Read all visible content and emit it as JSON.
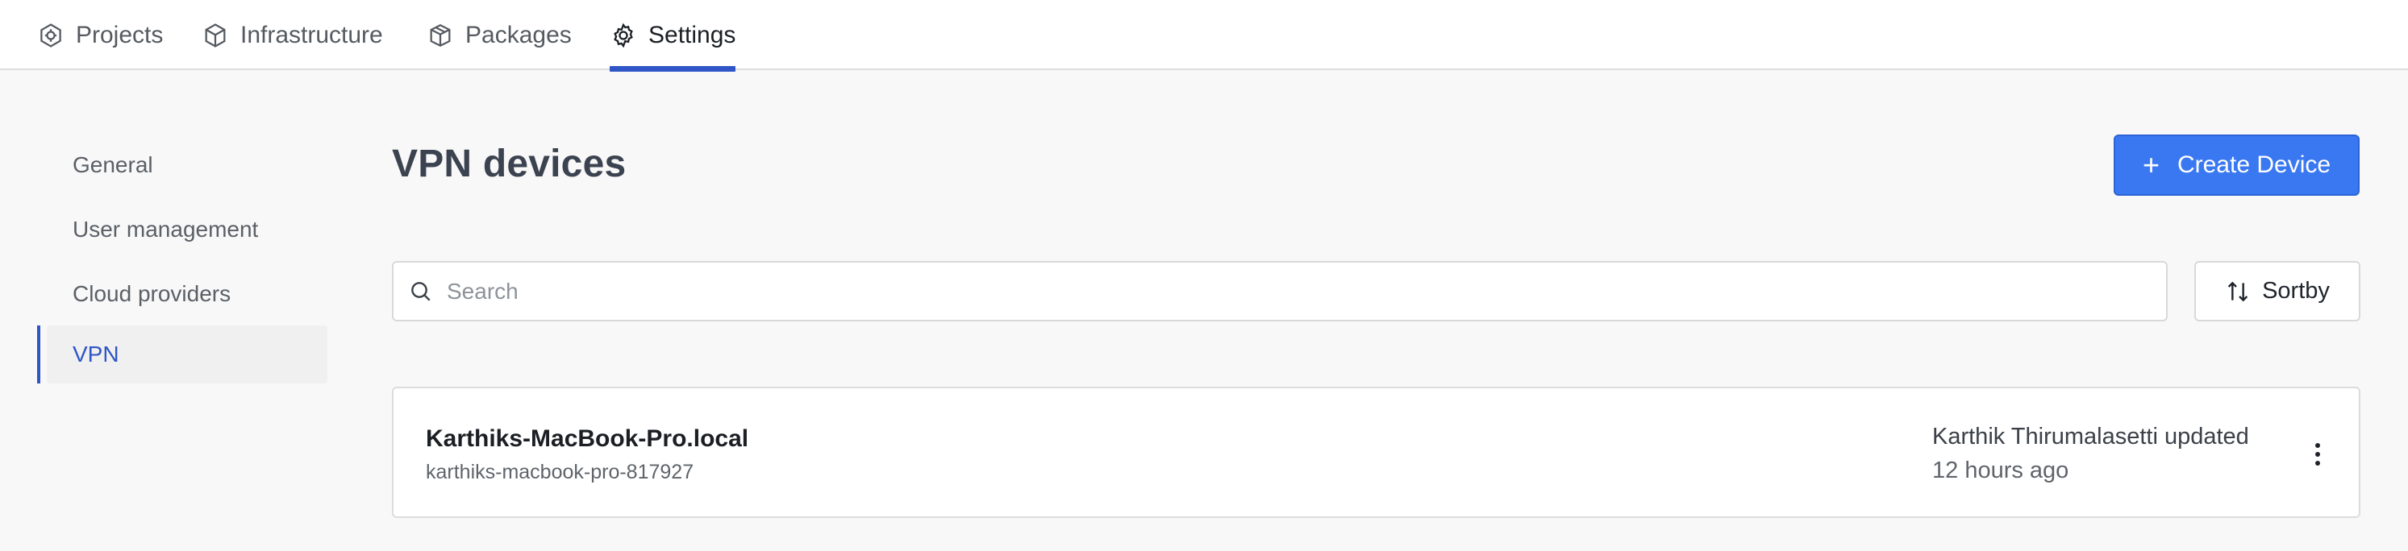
{
  "topnav": {
    "tabs": [
      {
        "label": "Projects",
        "icon": "hexagon-gear-icon",
        "active": false
      },
      {
        "label": "Infrastructure",
        "icon": "cube-icon",
        "active": false
      },
      {
        "label": "Packages",
        "icon": "box-icon",
        "active": false
      },
      {
        "label": "Settings",
        "icon": "gear-icon",
        "active": true
      }
    ],
    "accent": "#2f55c6"
  },
  "sidebar": {
    "items": [
      {
        "label": "General",
        "active": false
      },
      {
        "label": "User management",
        "active": false
      },
      {
        "label": "Cloud providers",
        "active": false
      },
      {
        "label": "VPN",
        "active": true
      }
    ]
  },
  "main": {
    "title": "VPN devices",
    "create_button": {
      "label": "Create Device",
      "icon": "plus-icon",
      "color": "#3a78f2"
    },
    "search": {
      "placeholder": "Search",
      "value": "",
      "icon": "search-icon"
    },
    "sort_button": {
      "label": "Sortby",
      "icon": "sort-arrows-icon"
    },
    "devices": [
      {
        "name": "Karthiks-MacBook-Pro.local",
        "slug": "karthiks-macbook-pro-817927",
        "updated_by": "Karthik Thirumalasetti updated",
        "updated_at": "12 hours ago",
        "menu_icon": "kebab-menu-icon"
      }
    ]
  }
}
